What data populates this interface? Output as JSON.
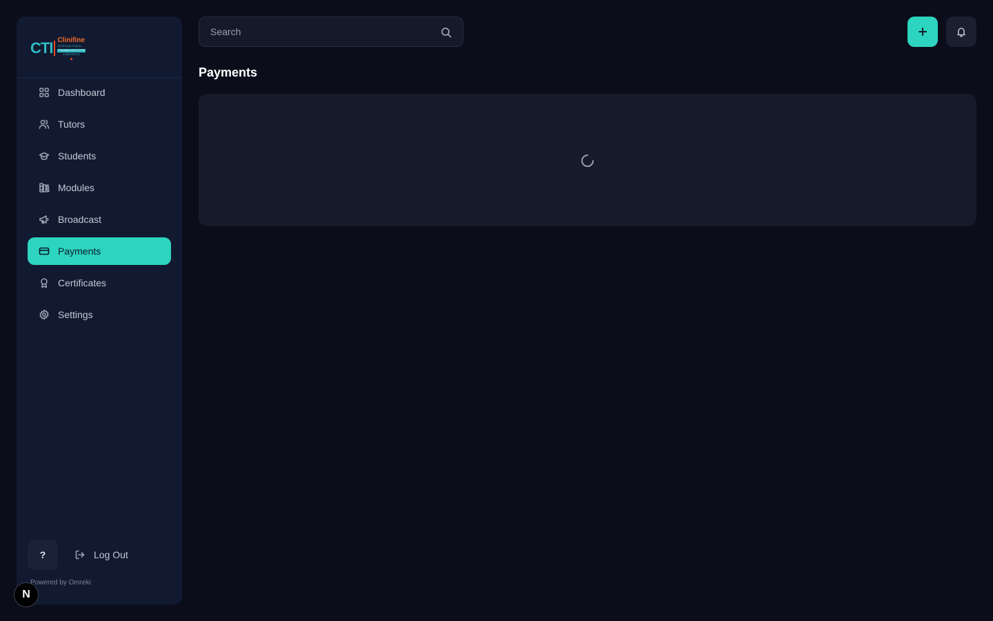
{
  "brand": {
    "logo_mark": "CTI",
    "logo_name": "Clinifine",
    "logo_line1": "INTERNATIONAL",
    "logo_line2": "TRAINING INSTITUTE",
    "logo_line3": "& AESTHETICS"
  },
  "sidebar": {
    "items": [
      {
        "label": "Dashboard",
        "icon": "grid-icon",
        "active": false
      },
      {
        "label": "Tutors",
        "icon": "users-icon",
        "active": false
      },
      {
        "label": "Students",
        "icon": "graduation-cap-icon",
        "active": false
      },
      {
        "label": "Modules",
        "icon": "library-icon",
        "active": false
      },
      {
        "label": "Broadcast",
        "icon": "megaphone-icon",
        "active": false
      },
      {
        "label": "Payments",
        "icon": "credit-card-icon",
        "active": true
      },
      {
        "label": "Certificates",
        "icon": "award-icon",
        "active": false
      },
      {
        "label": "Settings",
        "icon": "gear-icon",
        "active": false
      }
    ],
    "help_label": "?",
    "logout_label": "Log Out",
    "powered_by": "Powered by Omreki"
  },
  "header": {
    "search_placeholder": "Search",
    "search_value": ""
  },
  "main": {
    "title": "Payments",
    "status": "loading"
  },
  "dev_badge": "N",
  "colors": {
    "accent": "#2dd4bf",
    "background": "#0b0e1a",
    "sidebar": "#111a30",
    "card": "#161a2a"
  }
}
